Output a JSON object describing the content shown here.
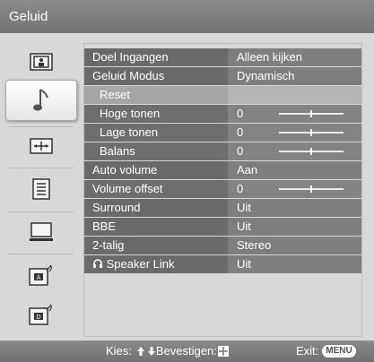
{
  "header": {
    "title": "Geluid"
  },
  "sidebar": {
    "items": [
      {
        "icon": "picture-icon"
      },
      {
        "icon": "music-note-icon",
        "active": true
      },
      {
        "icon": "screen-adjust-icon"
      },
      {
        "icon": "setup-list-icon"
      },
      {
        "icon": "pc-monitor-icon"
      },
      {
        "icon": "analog-antenna-icon"
      },
      {
        "icon": "digital-antenna-icon"
      }
    ]
  },
  "menu": {
    "rows": [
      {
        "label": "Doel Ingangen",
        "value": "Alleen kijken"
      },
      {
        "label": "Geluid Modus",
        "value": "Dynamisch"
      },
      {
        "label": "Reset",
        "value": ""
      },
      {
        "label": "Hoge tonen",
        "value": "0",
        "slider": 0.5
      },
      {
        "label": "Lage tonen",
        "value": "0",
        "slider": 0.5
      },
      {
        "label": "Balans",
        "value": "0",
        "slider": 0.5
      },
      {
        "label": "Auto volume",
        "value": "Aan"
      },
      {
        "label": "Volume offset",
        "value": "0",
        "slider": 0.5
      },
      {
        "label": "Surround",
        "value": "Uit"
      },
      {
        "label": "BBE",
        "value": "Uit"
      },
      {
        "label": "2-talig",
        "value": "Stereo"
      },
      {
        "label": "Speaker Link",
        "value": "Uit",
        "icon": "headphones-icon"
      }
    ]
  },
  "footer": {
    "select_label": "Kies:",
    "confirm_label": "Bevestigen:",
    "exit_label": "Exit:",
    "exit_key": "MENU"
  }
}
